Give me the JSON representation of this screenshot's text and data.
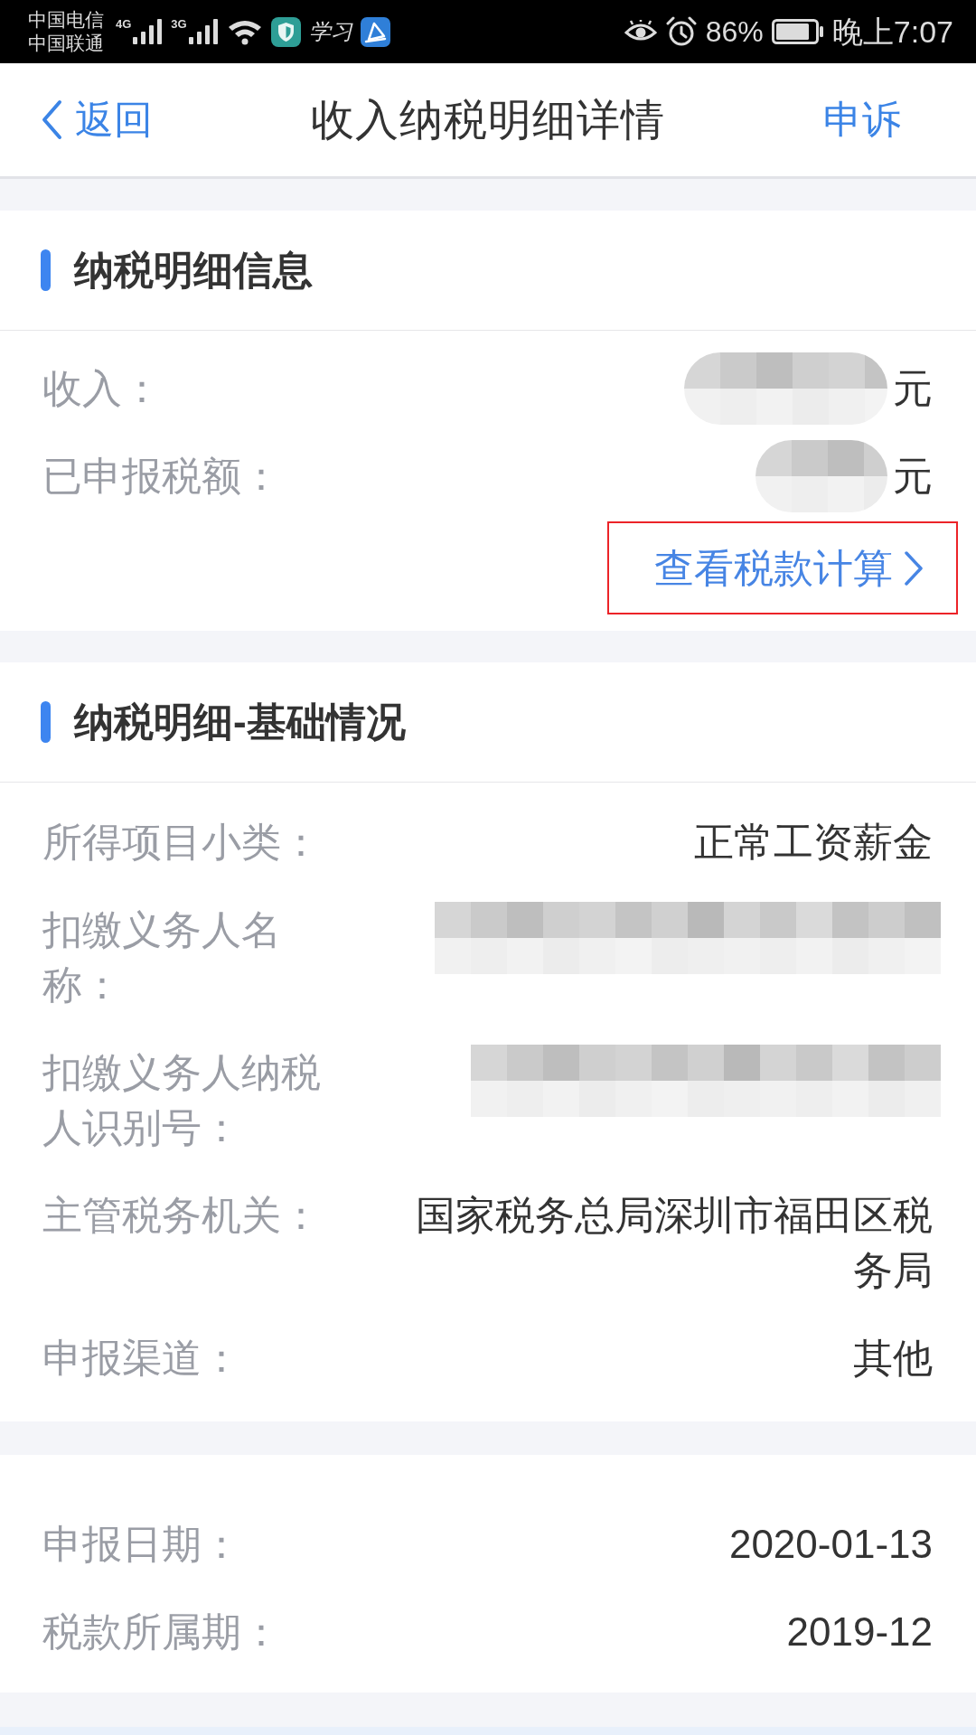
{
  "status_bar": {
    "carriers": [
      "中国电信",
      "中国联通"
    ],
    "signals": [
      {
        "network": "4G"
      },
      {
        "network": "3G"
      }
    ],
    "app_logo_text": "学习",
    "battery": "86%",
    "time": "晚上7:07"
  },
  "nav": {
    "back": "返回",
    "title": "收入纳税明细详情",
    "action": "申诉"
  },
  "sections": [
    {
      "title": "纳税明细信息",
      "rows": [
        {
          "label": "收入：",
          "kind": "redacted",
          "unit": "元"
        },
        {
          "label": "已申报税额：",
          "kind": "redacted",
          "unit": "元"
        }
      ],
      "link": {
        "label": "查看税款计算",
        "highlighted": true
      }
    },
    {
      "title": "纳税明细-基础情况",
      "rows": [
        {
          "label": "所得项目小类：",
          "kind": "text",
          "value": "正常工资薪金"
        },
        {
          "label": "扣缴义务人名称：",
          "kind": "redacted"
        },
        {
          "label": "扣缴义务人纳税人识别号：",
          "kind": "redacted"
        },
        {
          "label": "主管税务机关：",
          "kind": "text",
          "value": "国家税务总局深圳市福田区税务局"
        },
        {
          "label": "申报渠道：",
          "kind": "text",
          "value": "其他"
        }
      ]
    },
    {
      "rows": [
        {
          "label": "申报日期：",
          "kind": "text",
          "value": "2020-01-13"
        },
        {
          "label": "税款所属期：",
          "kind": "text",
          "value": "2019-12"
        }
      ]
    }
  ]
}
